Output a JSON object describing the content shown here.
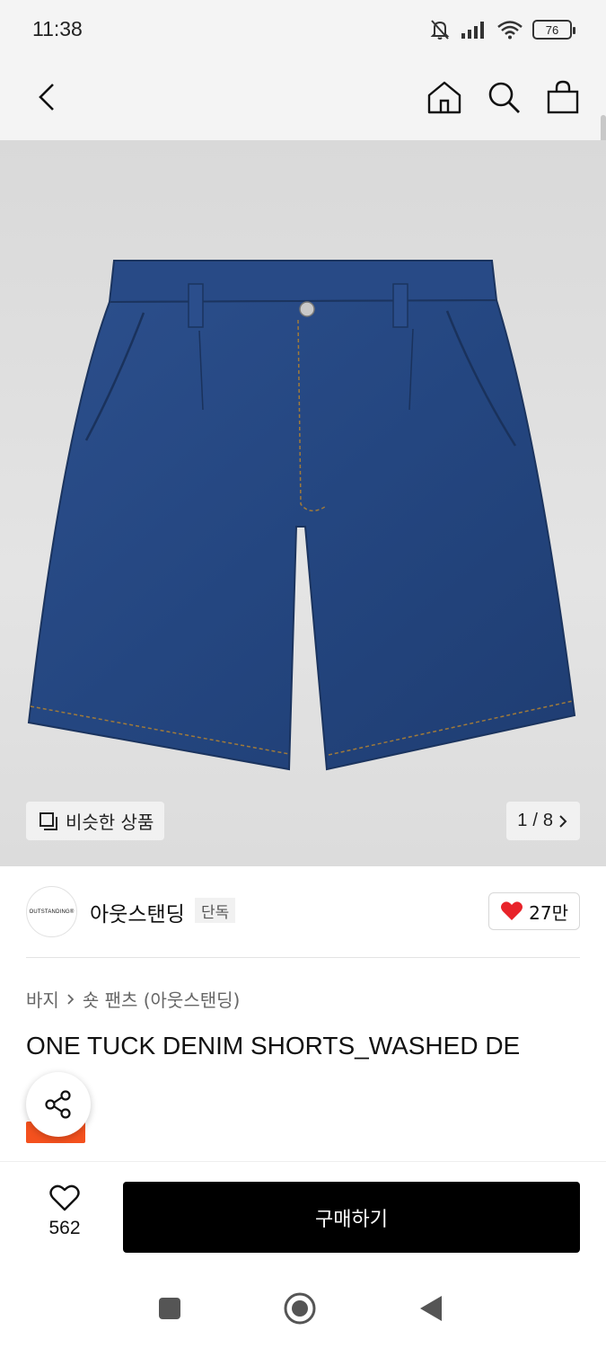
{
  "status_bar": {
    "time": "11:38",
    "battery": "76"
  },
  "nav": {
    "back_icon": "chevron-left-icon",
    "home_icon": "home-icon",
    "search_icon": "search-icon",
    "cart_icon": "shopping-bag-icon"
  },
  "gallery": {
    "similar_label": "비슷한 상품",
    "pager_current": "1",
    "pager_sep": "/",
    "pager_total": "8"
  },
  "brand": {
    "logo_text": "OUTSTANDING®",
    "name": "아웃스탠딩",
    "tag": "단독",
    "like_count": "27만",
    "like_color": "#e8232a"
  },
  "breadcrumb": {
    "category": "바지",
    "subcategory": "숏 팬츠 (아웃스탠딩)"
  },
  "product": {
    "title": "ONE TUCK DENIM SHORTS_WASHED DE"
  },
  "bottom_bar": {
    "wish_count": "562",
    "buy_label": "구매하기"
  },
  "colors": {
    "accent": "#f4511e",
    "button": "#000000"
  }
}
